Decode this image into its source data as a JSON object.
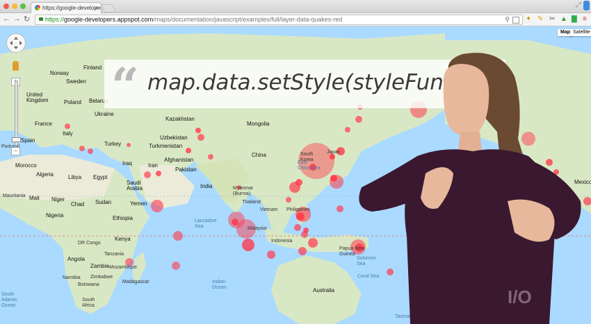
{
  "browser": {
    "tab_title": "https://google-developer",
    "tab_close": "×",
    "url_scheme": "https://",
    "url_host": "google-developers.appspot.com",
    "url_path": "/maps/documentation/javascript/examples/full/layer-data-quakes-red"
  },
  "map": {
    "map_type_options": [
      "Map",
      "Satellite"
    ],
    "selected_type": "Map",
    "zoom_in": "+",
    "zoom_out": "−",
    "colors": {
      "water": "#aadaff",
      "land": "#d9e8c4",
      "desert": "#ecebd9",
      "quake": "#ff3b4e"
    },
    "labels": {
      "finland": "Finland",
      "sweden": "Sweden",
      "norway": "Norway",
      "united_kingdom": "United\nKingdom",
      "poland": "Poland",
      "belarus": "Belarus",
      "ukraine": "Ukraine",
      "france": "France",
      "spain": "Spain",
      "italy": "Italy",
      "portugal": "Portugal",
      "turkey": "Turkey",
      "kazakhstan": "Kazakhstan",
      "mongolia": "Mongolia",
      "uzbekistan": "Uzbekistan",
      "turkmenistan": "Turkmenistan",
      "china": "China",
      "afghanistan": "Afghanistan",
      "pakistan": "Pakistan",
      "iraq": "Iraq",
      "iran": "Iran",
      "south_korea": "South\nKorea",
      "east_china_sea": "East\nChina Sea",
      "japan": "Japan",
      "morocco": "Morocco",
      "algeria": "Algeria",
      "libya": "Libya",
      "egypt": "Egypt",
      "saudi_arabia": "Saudi\nArabia",
      "india": "India",
      "myanmar": "Myanmar\n(Burma)",
      "thailand": "Thailand",
      "vietnam": "Vietnam",
      "philippines": "Philippines",
      "mauritania": "Mauritania",
      "mali": "Mali",
      "niger": "Niger",
      "chad": "Chad",
      "sudan": "Sudan",
      "yemen": "Yemen",
      "ethiopia": "Ethiopia",
      "nigeria": "Nigeria",
      "malaysia": "Malaysia",
      "dr_congo": "DR Congo",
      "kenya": "Kenya",
      "tanzania": "Tanzania",
      "indonesia": "Indonesia",
      "papua_new_guinea": "Papua New\nGuinea",
      "angola": "Angola",
      "zambia": "Zambia",
      "mozambique": "Mozambique",
      "namibia": "Namibia",
      "zimbabwe": "Zimbabwe",
      "botswana": "Botswana",
      "madagascar": "Madagascar",
      "south_africa": "South\nAfrica",
      "australia": "Australia",
      "indian_ocean": "Indian\nOcean",
      "coral_sea": "Coral Sea",
      "solomon_sea": "Solomon\nSea",
      "mexico": "Mexico",
      "laccadive_sea": "Laccadive\nSea",
      "south_atlantic": "South\nAtlantic\nOcean",
      "tasman": "Tasman"
    }
  },
  "caption": {
    "quote_mark": "“",
    "code": "map.data.setStyle(styleFunction"
  }
}
